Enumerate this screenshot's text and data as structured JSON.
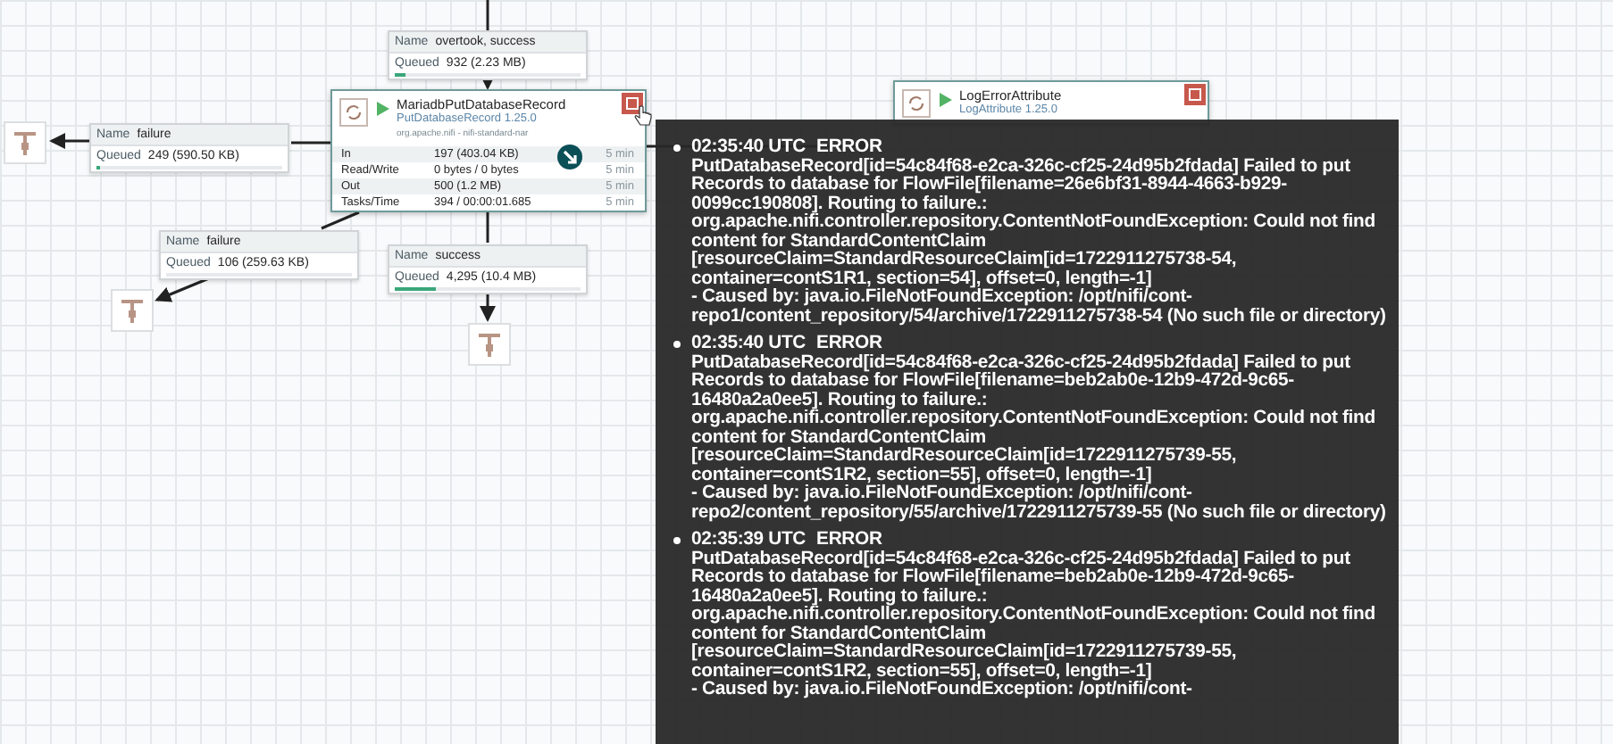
{
  "connections": [
    {
      "name_label": "Name",
      "name": "overtook, success",
      "queued_label": "Queued",
      "queued": "932 (2.23 MB)",
      "level": 0.06
    },
    {
      "name_label": "Name",
      "name": "failure",
      "queued_label": "Queued",
      "queued": "249 (590.50 KB)",
      "level": 0.02
    },
    {
      "name_label": "Name",
      "name": "failure",
      "queued_label": "Queued",
      "queued": "106 (259.63 KB)"
    },
    {
      "name_label": "Name",
      "name": "success",
      "queued_label": "Queued",
      "queued": "4,295 (10.4 MB)",
      "level": 0.22
    }
  ],
  "processors": [
    {
      "name": "MariadbPutDatabaseRecord",
      "type": "PutDatabaseRecord 1.25.0",
      "bundle": "org.apache.nifi - nifi-standard-nar",
      "running": true,
      "has_bulletin": true,
      "stats": [
        {
          "label": "In",
          "value": "197 (403.04 KB)",
          "window": "5 min"
        },
        {
          "label": "Read/Write",
          "value": "0 bytes / 0 bytes",
          "window": "5 min"
        },
        {
          "label": "Out",
          "value": "500 (1.2 MB)",
          "window": "5 min"
        },
        {
          "label": "Tasks/Time",
          "value": "394 / 00:00:01.685",
          "window": "5 min"
        }
      ]
    },
    {
      "name": "LogErrorAttribute",
      "type": "LogAttribute 1.25.0",
      "running": true,
      "has_bulletin": true
    }
  ],
  "bulletins": [
    {
      "time": "02:35:40 UTC",
      "level": "ERROR",
      "message": "PutDatabaseRecord[id=54c84f68-e2ca-326c-cf25-24d95b2fdada] Failed to put Records to database for FlowFile[filename=26e6bf31-8944-4663-b929-0099cc190808]. Routing to failure.: org.apache.nifi.controller.repository.ContentNotFoundException: Could not find content for StandardContentClaim [resourceClaim=StandardResourceClaim[id=1722911275738-54, container=contS1R1, section=54], offset=0, length=-1]\n- Caused by: java.io.FileNotFoundException: /opt/nifi/cont-repo1/content_repository/54/archive/1722911275738-54 (No such file or directory)"
    },
    {
      "time": "02:35:40 UTC",
      "level": "ERROR",
      "message": "PutDatabaseRecord[id=54c84f68-e2ca-326c-cf25-24d95b2fdada] Failed to put Records to database for FlowFile[filename=beb2ab0e-12b9-472d-9c65-16480a2a0ee5]. Routing to failure.: org.apache.nifi.controller.repository.ContentNotFoundException: Could not find content for StandardContentClaim [resourceClaim=StandardResourceClaim[id=1722911275739-55, container=contS1R2, section=55], offset=0, length=-1]\n- Caused by: java.io.FileNotFoundException: /opt/nifi/cont-repo2/content_repository/55/archive/1722911275739-55 (No such file or directory)"
    },
    {
      "time": "02:35:39 UTC",
      "level": "ERROR",
      "message": "PutDatabaseRecord[id=54c84f68-e2ca-326c-cf25-24d95b2fdada] Failed to put Records to database for FlowFile[filename=beb2ab0e-12b9-472d-9c65-16480a2a0ee5]. Routing to failure.: org.apache.nifi.controller.repository.ContentNotFoundException: Could not find content for StandardContentClaim [resourceClaim=StandardResourceClaim[id=1722911275739-55, container=contS1R2, section=55], offset=0, length=-1]\n- Caused by: java.io.FileNotFoundException: /opt/nifi/cont-"
    }
  ]
}
